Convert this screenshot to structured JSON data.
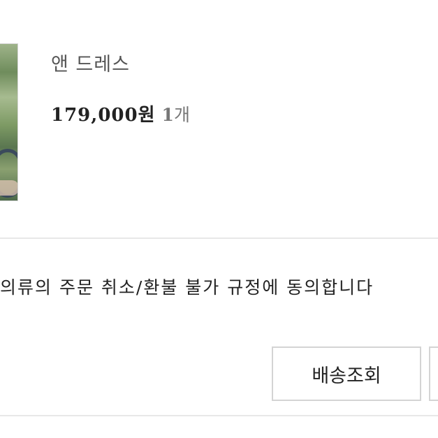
{
  "product": {
    "thumbnail_icon": "product-photo",
    "name": "앤 드레스",
    "price": "179,000",
    "price_unit": "원",
    "quantity_number": "1",
    "quantity_unit": "개"
  },
  "agreement": {
    "text": "의류의 주문 취소/환불 불가 규정에 동의합니다"
  },
  "actions": {
    "track_delivery_label": "배송조회",
    "next_button_label": ""
  }
}
